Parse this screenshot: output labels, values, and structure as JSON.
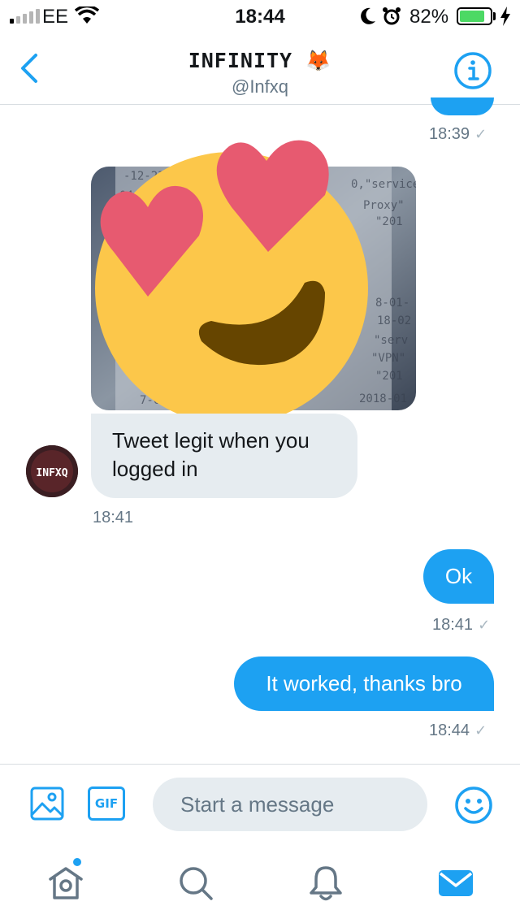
{
  "status_bar": {
    "carrier": "EE",
    "time": "18:44",
    "battery_percent": "82%",
    "battery_level": 0.82
  },
  "header": {
    "title": "INFINITY 🦊",
    "handle": "@Infxq"
  },
  "conversation": {
    "timestamps": {
      "previous": "18:39",
      "incoming": "18:41",
      "ok": "18:41",
      "worked": "18:44"
    },
    "incoming_message": "Tweet legit when you logged in",
    "outgoing_ok": "Ok",
    "outgoing_worked": "It worked, thanks bro",
    "read_check": "✓",
    "avatar_text": "INFXQ"
  },
  "composer": {
    "placeholder": "Start a message",
    "gif_label": "GIF"
  },
  "colors": {
    "accent": "#1da1f2",
    "bubble_incoming": "#e6ecf0",
    "secondary_text": "#657786"
  },
  "icons": {
    "back": "chevron-left-icon",
    "info": "info-icon",
    "image": "image-icon",
    "gif": "gif-icon",
    "emoji": "smiley-icon",
    "home": "home-icon",
    "search": "search-icon",
    "notifications": "bell-icon",
    "messages": "envelope-icon"
  }
}
